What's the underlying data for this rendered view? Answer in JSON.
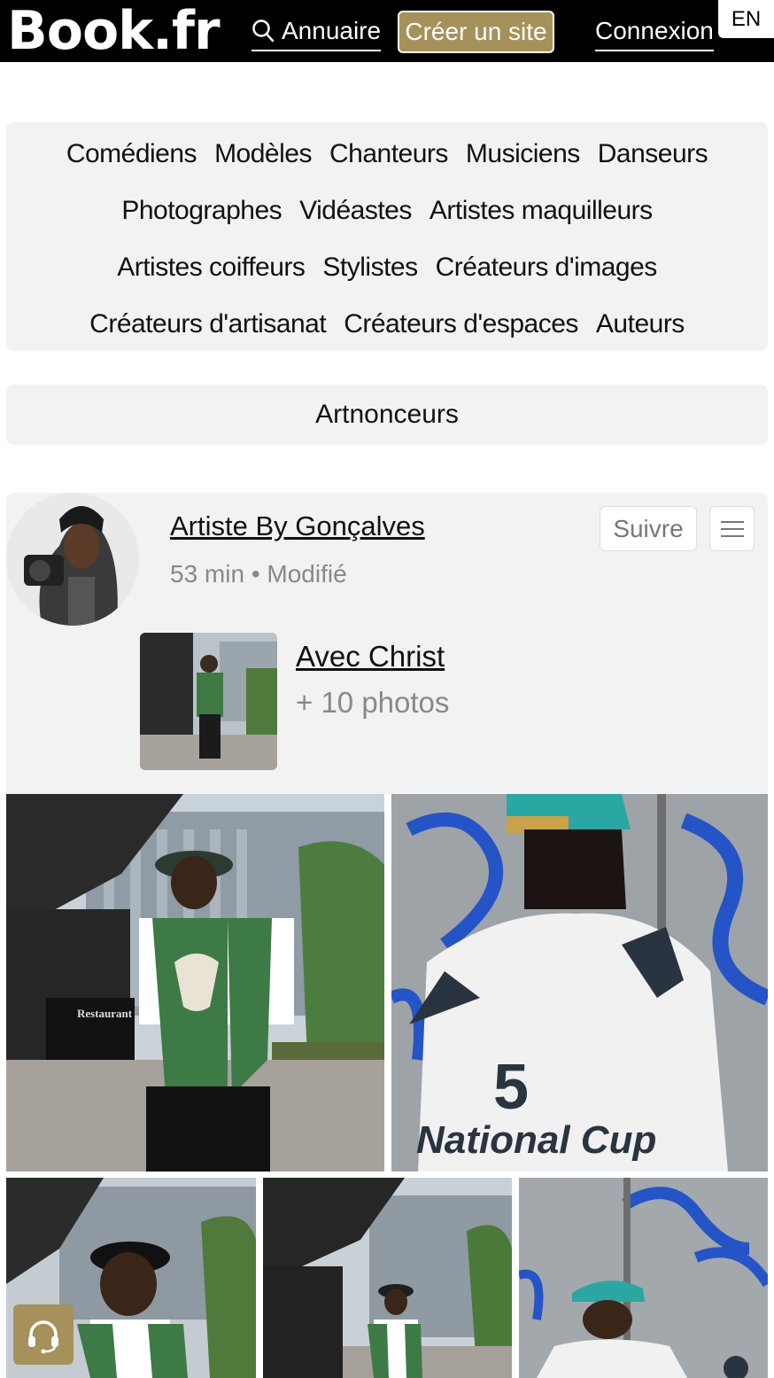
{
  "header": {
    "logo": "Book.fr",
    "directory_label": "Annuaire",
    "create_site_label": "Créer un site",
    "login_label": "Connexion",
    "language": "EN"
  },
  "categories": {
    "rows": [
      [
        "Comédiens",
        "Modèles",
        "Chanteurs",
        "Musiciens",
        "Danseurs"
      ],
      [
        "Photographes",
        "Vidéastes",
        "Artistes maquilleurs"
      ],
      [
        "Artistes coiffeurs",
        "Stylistes",
        "Créateurs d'images"
      ],
      [
        "Créateurs d'artisanat",
        "Créateurs d'espaces",
        "Auteurs"
      ]
    ]
  },
  "advertisers": {
    "label": "Artnonceurs"
  },
  "post": {
    "author": "Artiste By Gonçalves",
    "meta": "53 min • Modifié",
    "follow_label": "Suivre",
    "album": {
      "title": "Avec Christ",
      "count": "+ 10 photos"
    }
  },
  "photo_overlays": {
    "restaurant_sign": "Restaurant",
    "jersey_number": "5",
    "jersey_text": "National Cup"
  },
  "icons": {
    "directory": "search-icon",
    "menu": "hamburger-menu-icon",
    "support": "headset-icon"
  },
  "colors": {
    "brand_gold": "#a7915a",
    "header_bg": "#000000",
    "panel_bg": "#f2f2f2"
  }
}
